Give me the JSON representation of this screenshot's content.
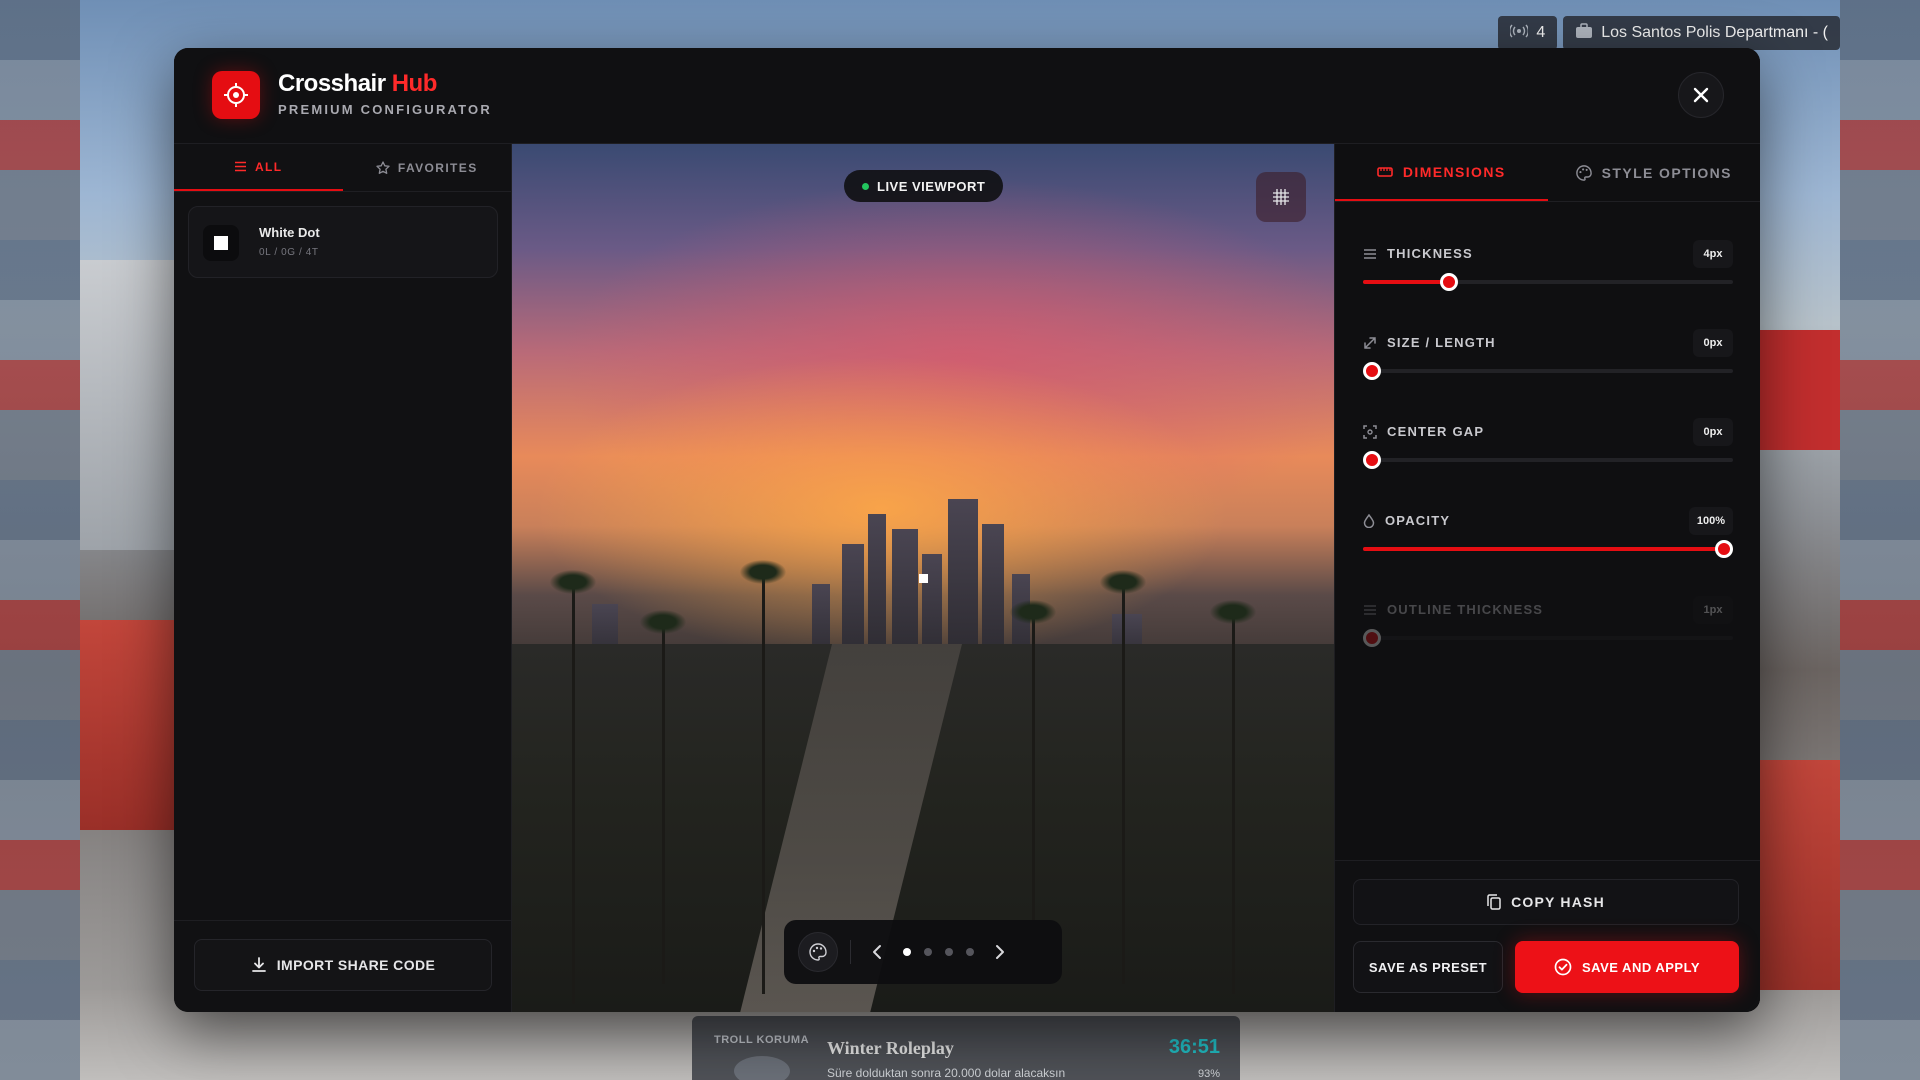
{
  "hud": {
    "voice_count": "4",
    "job_label": "Los Santos Polis Departmanı - (",
    "bottom_tag": "TROLL KORUMA",
    "bottom_title": "Winter Roleplay",
    "bottom_timer": "36:51",
    "bottom_subtitle": "Süre dolduktan sonra 20.000 dolar alacaksın",
    "bottom_percent": "93%"
  },
  "app": {
    "name": "Crosshair",
    "name_accent": "Hub",
    "tagline": "PREMIUM CONFIGURATOR",
    "accent_color": "#e50d12"
  },
  "left": {
    "tabs": [
      {
        "label": "ALL",
        "icon": "list-icon",
        "active": true
      },
      {
        "label": "FAVORITES",
        "icon": "star-icon",
        "active": false
      }
    ],
    "presets": [
      {
        "name": "White Dot",
        "meta": "0L / 0G / 4T"
      }
    ],
    "import_label": "IMPORT SHARE CODE"
  },
  "viewport": {
    "pill_label": "LIVE VIEWPORT",
    "page_count": 4,
    "active_page": 1
  },
  "right": {
    "tabs": [
      {
        "label": "DIMENSIONS",
        "icon": "ruler-icon",
        "active": true
      },
      {
        "label": "STYLE OPTIONS",
        "icon": "palette-icon",
        "active": false
      }
    ],
    "sliders": [
      {
        "key": "thickness",
        "label": "THICKNESS",
        "value": "4px",
        "fraction": 0.22,
        "disabled": false
      },
      {
        "key": "size",
        "label": "SIZE / LENGTH",
        "value": "0px",
        "fraction": 0.0,
        "disabled": false
      },
      {
        "key": "gap",
        "label": "CENTER GAP",
        "value": "0px",
        "fraction": 0.0,
        "disabled": false
      },
      {
        "key": "opacity",
        "label": "OPACITY",
        "value": "100%",
        "fraction": 1.0,
        "disabled": false
      },
      {
        "key": "outline",
        "label": "OUTLINE THICKNESS",
        "value": "1px",
        "fraction": 0.0,
        "disabled": true
      }
    ],
    "copy_hash_label": "COPY HASH",
    "save_preset_label": "SAVE AS PRESET",
    "save_apply_label": "SAVE AND APPLY"
  }
}
